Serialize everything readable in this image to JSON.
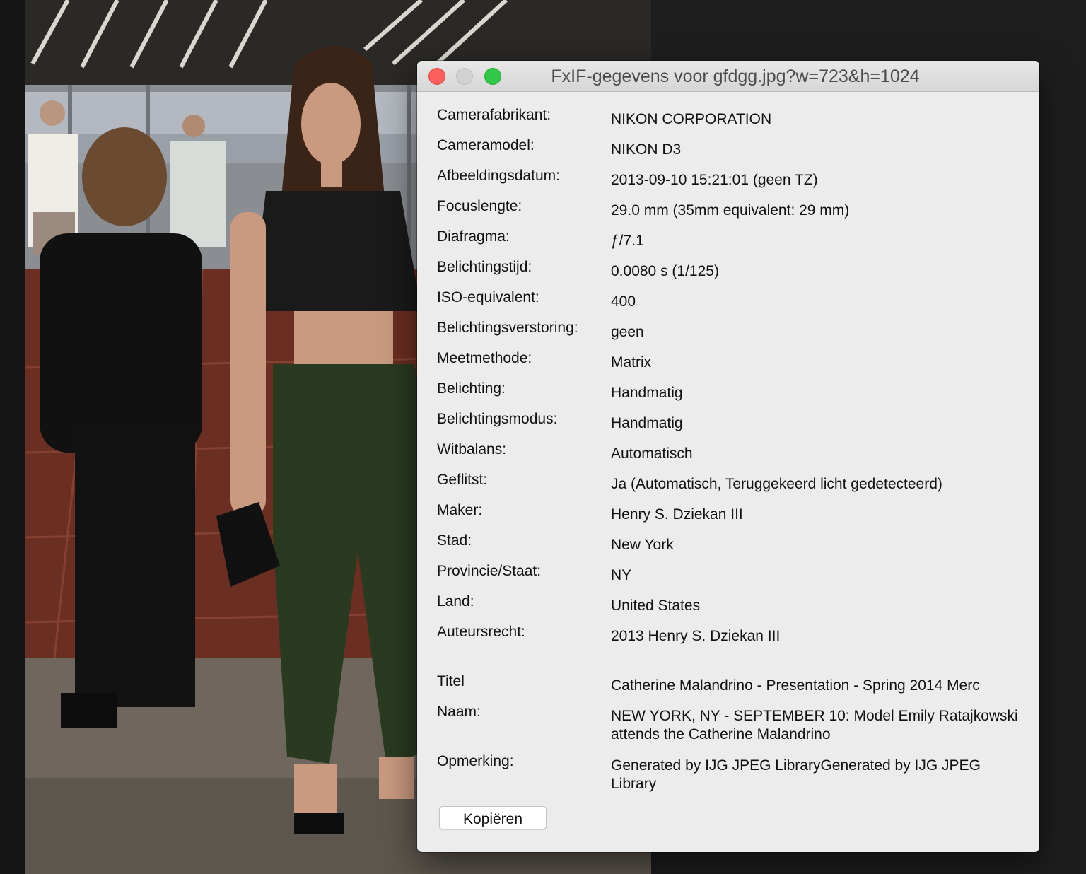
{
  "window": {
    "title": "FxIF-gegevens voor gfdgg.jpg?w=723&h=1024"
  },
  "exif": [
    {
      "label": "Camerafabrikant:",
      "value": "NIKON CORPORATION"
    },
    {
      "label": "Cameramodel:",
      "value": "NIKON D3"
    },
    {
      "label": "Afbeeldingsdatum:",
      "value": "2013-09-10 15:21:01 (geen TZ)"
    },
    {
      "label": "Focuslengte:",
      "value": "29.0 mm (35mm equivalent: 29 mm)"
    },
    {
      "label": "Diafragma:",
      "value": "ƒ/7.1"
    },
    {
      "label": "Belichtingstijd:",
      "value": "0.0080 s (1/125)"
    },
    {
      "label": "ISO-equivalent:",
      "value": "400"
    },
    {
      "label": "Belichtingsverstoring:",
      "value": "geen"
    },
    {
      "label": "Meetmethode:",
      "value": "Matrix"
    },
    {
      "label": "Belichting:",
      "value": "Handmatig"
    },
    {
      "label": "Belichtingsmodus:",
      "value": "Handmatig"
    },
    {
      "label": "Witbalans:",
      "value": "Automatisch"
    },
    {
      "label": "Geflitst:",
      "value": "Ja (Automatisch, Teruggekeerd licht gedetecteerd)"
    },
    {
      "label": "Maker:",
      "value": "Henry S. Dziekan III"
    },
    {
      "label": "Stad:",
      "value": "New York"
    },
    {
      "label": "Provincie/Staat:",
      "value": "NY"
    },
    {
      "label": "Land:",
      "value": "United States"
    },
    {
      "label": "Auteursrecht:",
      "value": "2013 Henry S. Dziekan III"
    }
  ],
  "extra": [
    {
      "label": "Titel",
      "value": "Catherine Malandrino - Presentation - Spring 2014 Merc"
    },
    {
      "label": "Naam:",
      "value": "NEW YORK, NY - SEPTEMBER 10:  Model Emily Ratajkowski attends the Catherine Malandrino"
    },
    {
      "label": "Opmerking:",
      "value": "Generated by  IJG JPEG LibraryGenerated by  IJG JPEG Library"
    }
  ],
  "copy_button_label": "Kopiëren",
  "colors": {
    "close": "#fc605c",
    "minimize": "#d2d2d2",
    "zoom": "#34c84a",
    "window_bg": "#ececec"
  }
}
